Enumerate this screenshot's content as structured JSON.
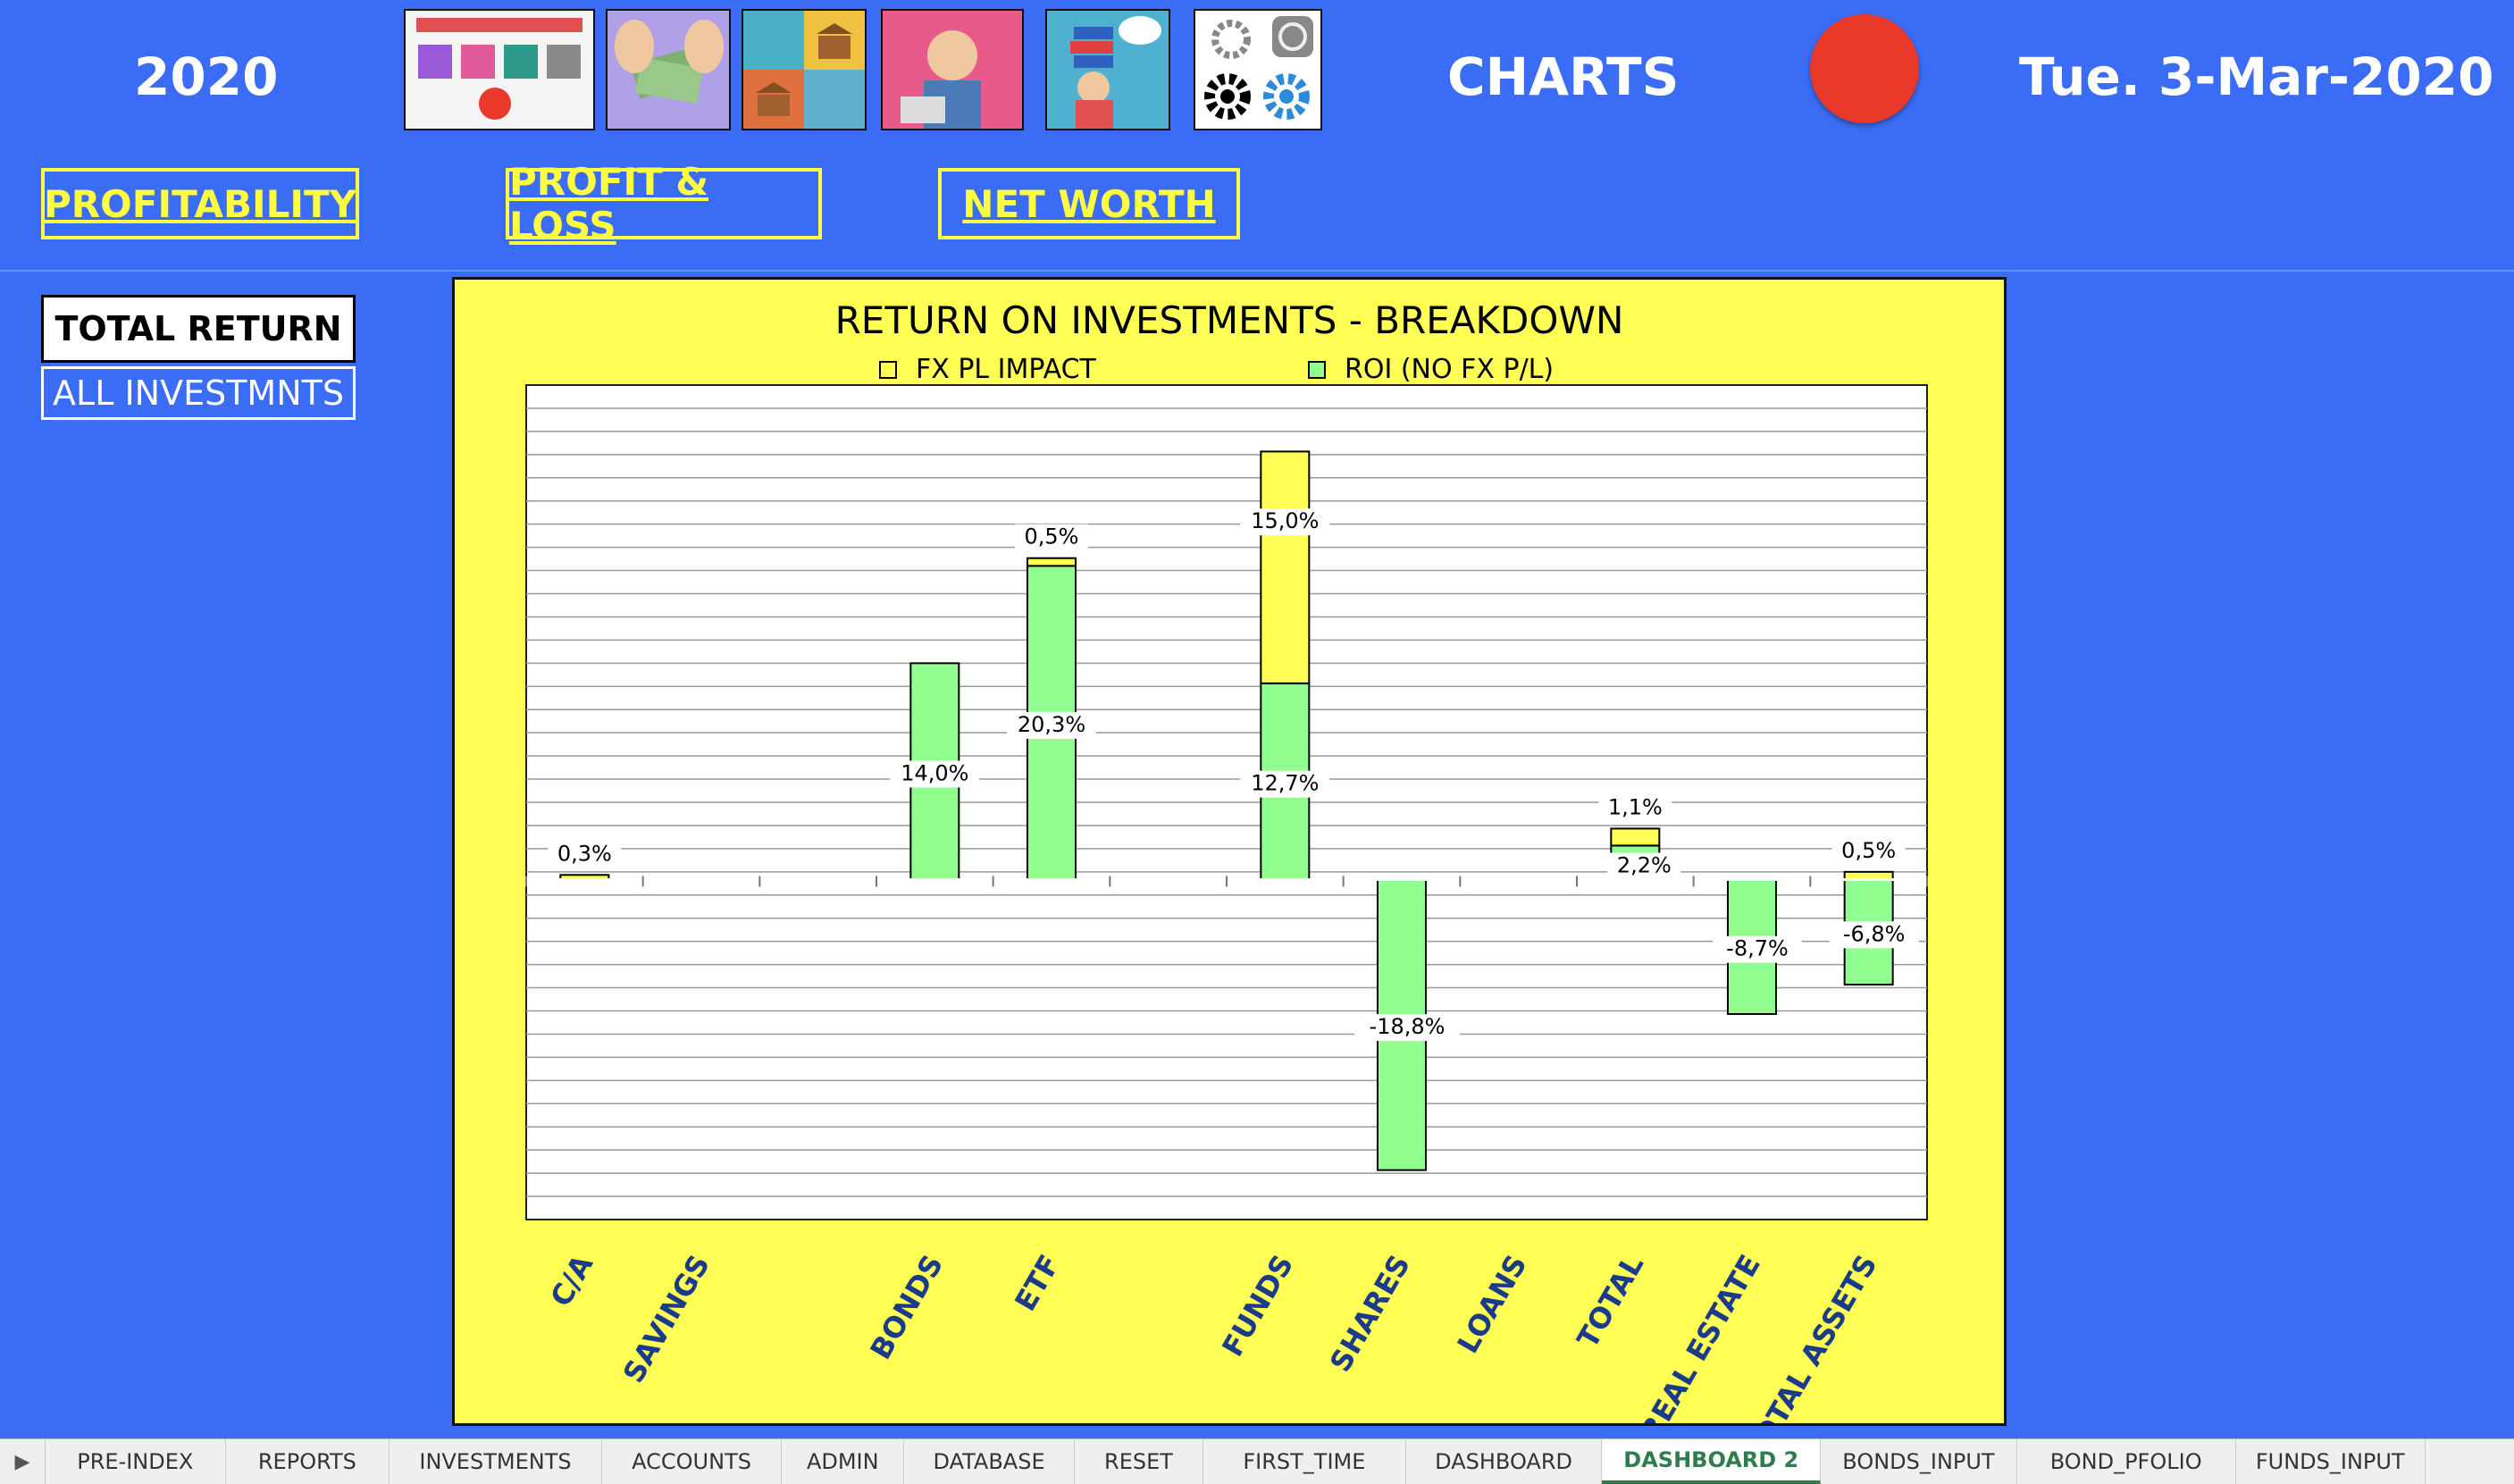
{
  "header": {
    "year": "2020",
    "section_title": "CHARTS",
    "date": "Tue. 3-Mar-2020",
    "status_color": "#e8392a"
  },
  "nav": {
    "profitability": "PROFITABILITY",
    "profit_loss": "PROFIT & LOSS",
    "net_worth": "NET WORTH"
  },
  "side": {
    "total_return": "TOTAL RETURN",
    "all_investments": "ALL INVESTMNTS"
  },
  "icons": [
    "dashboard-icon",
    "money-icon",
    "banking-icon",
    "stress-icon",
    "documents-icon",
    "settings-icon"
  ],
  "chart_data": {
    "type": "bar",
    "stacked": true,
    "title": "RETURN ON INVESTMENTS - BREAKDOWN",
    "categories": [
      "C/A",
      "SAVINGS",
      "",
      "BONDS",
      "ETF",
      "",
      "FUNDS",
      "SHARES",
      "LOANS",
      "TOTAL",
      "REAL ESTATE",
      "TOTAL ASSETS"
    ],
    "series": [
      {
        "name": "ROI (NO FX P/L)",
        "color": "#90ff90",
        "values": [
          0,
          0,
          null,
          14.0,
          20.3,
          null,
          12.7,
          -18.8,
          0,
          2.2,
          -8.7,
          -6.8
        ],
        "labels": [
          "",
          "",
          "",
          "14,0%",
          "20,3%",
          "",
          "12,7%",
          "-18,8%",
          "",
          "2,2%",
          "-8,7%",
          "-6,8%"
        ]
      },
      {
        "name": "FX PL IMPACT",
        "color": "#ffff55",
        "values": [
          0.3,
          0,
          null,
          0,
          0.5,
          null,
          15.0,
          0,
          0,
          1.1,
          0,
          0.5
        ],
        "labels": [
          "0,3%",
          "",
          "",
          "",
          "0,5%",
          "",
          "15,0%",
          "",
          "",
          "1,1%",
          "",
          "0,5%"
        ]
      }
    ],
    "legend_placement": "top",
    "ylim": [
      -22,
      32
    ],
    "grid": true,
    "y_axis_labels_shown": false
  },
  "tabs": [
    "PRE-INDEX",
    "REPORTS",
    "INVESTMENTS",
    "ACCOUNTS",
    "ADMIN",
    "DATABASE",
    "RESET",
    "FIRST_TIME",
    "DASHBOARD",
    "DASHBOARD 2",
    "BONDS_INPUT",
    "BOND_PFOLIO",
    "FUNDS_INPUT"
  ],
  "active_tab": "DASHBOARD 2"
}
